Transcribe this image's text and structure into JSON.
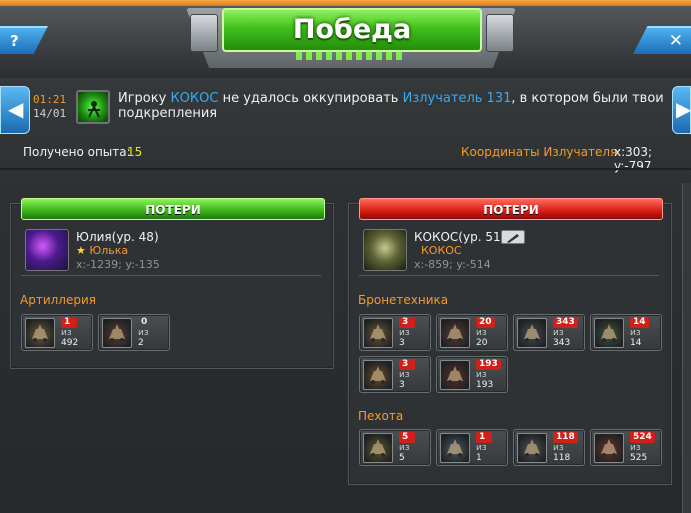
{
  "window": {
    "title": "Победа",
    "help_label": "?",
    "close_label": "✕"
  },
  "report": {
    "time": "01:21",
    "date": "14/01",
    "icon": "radiation-emitter-icon",
    "message_prefix": "Игроку ",
    "attacker": "КОКОС",
    "message_middle": "  не удалось оккупировать ",
    "target": "Излучатель 131",
    "message_suffix": ", в котором были твои подкрепления",
    "experience_label": "Получено опыта:",
    "experience_value": "15",
    "coordinates_label": "Координаты Излучателя:",
    "coordinates_value": "x:303; y:-797"
  },
  "left_panel": {
    "losses_label": "ПОТЕРИ",
    "player_name": "Юлия(ур. 48)",
    "alliance": "Юлька",
    "coords": "x:-1239; y:-135",
    "sections": [
      {
        "title": "Артиллерия",
        "units": [
          {
            "lost": "1",
            "of": "из",
            "total": "492",
            "icon": "artillery-tank-icon"
          },
          {
            "lost": "0",
            "of": "из",
            "total": "2",
            "icon": "heavy-artillery-icon"
          }
        ]
      }
    ]
  },
  "right_panel": {
    "losses_label": "ПОТЕРИ",
    "player_name": "КОКОС(ур. 51)",
    "alliance": "КОКОС",
    "coords": "x:-859; y:-514",
    "edit_icon": "pencil-icon",
    "sections": [
      {
        "title": "Бронетехника",
        "units": [
          {
            "lost": "3",
            "of": "из",
            "total": "3",
            "icon": "walker-mech-icon"
          },
          {
            "lost": "20",
            "of": "из",
            "total": "20",
            "icon": "spider-tank-icon"
          },
          {
            "lost": "343",
            "of": "из",
            "total": "343",
            "icon": "assault-tank-icon"
          },
          {
            "lost": "14",
            "of": "из",
            "total": "14",
            "icon": "hover-tank-icon"
          },
          {
            "lost": "3",
            "of": "из",
            "total": "3",
            "icon": "scorpion-tank-icon"
          },
          {
            "lost": "193",
            "of": "из",
            "total": "193",
            "icon": "crawler-tank-icon"
          }
        ]
      },
      {
        "title": "Пехота",
        "units": [
          {
            "lost": "5",
            "of": "из",
            "total": "5",
            "icon": "heavy-trooper-icon"
          },
          {
            "lost": "1",
            "of": "из",
            "total": "1",
            "icon": "sniper-icon"
          },
          {
            "lost": "118",
            "of": "из",
            "total": "118",
            "icon": "rifleman-icon"
          },
          {
            "lost": "524",
            "of": "из",
            "total": "525",
            "icon": "assault-trooper-icon"
          }
        ]
      }
    ]
  },
  "colors": {
    "accent_orange": "#f39b2a",
    "link_blue": "#3ba8f0",
    "experience_yellow": "#e9e226",
    "loss_red": "#d0201a",
    "win_green": "#41c01c"
  }
}
